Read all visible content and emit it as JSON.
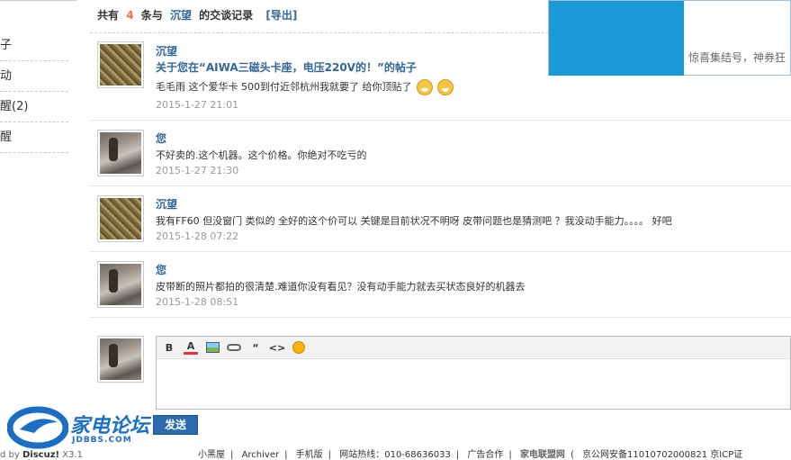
{
  "sidebar": {
    "items": [
      {
        "label": "子"
      },
      {
        "label": "动"
      },
      {
        "label": "醒(2)"
      },
      {
        "label": "醒"
      }
    ]
  },
  "header": {
    "prefix": "共有",
    "count": "4",
    "mid": "条与",
    "username": "沉望",
    "suffix": "的交谈记录",
    "export_label": "[导出]"
  },
  "ad": {
    "text": "惊喜集结号，神券狂"
  },
  "messages": [
    {
      "author": "沉望",
      "subject": "关于您在“AIWA三磁头卡座，电压220V的！”的帖子",
      "body": "毛毛雨 这个爱华卡 500到付近邻杭州我就要了 给你顶贴了",
      "time": "2015-1-27 21:01"
    },
    {
      "author": "您",
      "body": "不好卖的.这个机器。这个价格。你绝对不吃亏的",
      "time": "2015-1-27 21:30"
    },
    {
      "author": "沉望",
      "body": "我有FF60 但没窗门 类似的 全好的这个价可以 关键是目前状况不明呀 皮带问题也是猜测吧 ？我没动手能力。。。。 好吧",
      "time": "2015-1-28 07:22"
    },
    {
      "author": "您",
      "body": "皮带断的照片都拍的很清楚.难道你没有看见？没有动手能力就去买状态良好的机器去",
      "time": "2015-1-28 08:51"
    }
  ],
  "editor": {
    "toolbar": {
      "bold": "B",
      "color": "A",
      "quote": "“",
      "code": "<>"
    },
    "submit_label": "发送"
  },
  "logo": {
    "cn": "家电论坛",
    "en": "JDBBS.COM"
  },
  "footer": {
    "powered_prefix": "d by",
    "powered_brand": "Discuz!",
    "powered_version": "X3.1",
    "links": [
      "小黑屋",
      "Archiver",
      "手机版",
      "网站热线：010-68636033",
      "广告合作",
      "家电联盟网",
      "京公网安备11010702000821 京ICP证"
    ]
  }
}
